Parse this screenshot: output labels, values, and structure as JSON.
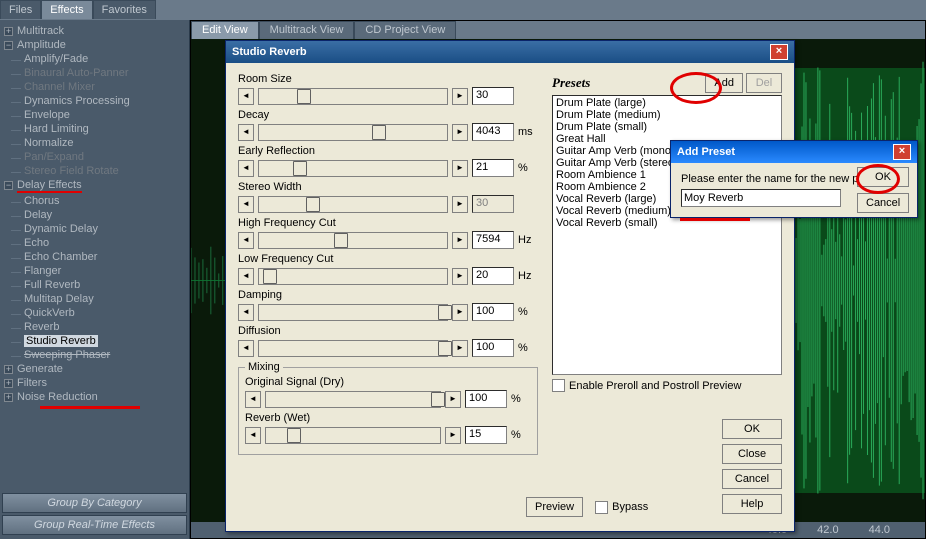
{
  "topbar": {
    "tabs": [
      "Files",
      "Effects",
      "Favorites"
    ],
    "active": 1
  },
  "wave": {
    "tabs": [
      "Edit View",
      "Multitrack View",
      "CD Project View"
    ],
    "active": 0,
    "timeline": [
      "40.0",
      "42.0",
      "44.0"
    ]
  },
  "tree": {
    "multitrack": "Multitrack",
    "amplitude": "Amplitude",
    "amp_children": [
      "Amplify/Fade",
      "Binaural Auto-Panner",
      "Channel Mixer",
      "Dynamics Processing",
      "Envelope",
      "Hard Limiting",
      "Normalize",
      "Pan/Expand",
      "Stereo Field Rotate"
    ],
    "delay": "Delay Effects",
    "delay_children": [
      "Chorus",
      "Delay",
      "Dynamic Delay",
      "Echo",
      "Echo Chamber",
      "Flanger",
      "Full Reverb",
      "Multitap Delay",
      "QuickVerb",
      "Reverb",
      "Studio Reverb",
      "Sweeping Phaser"
    ],
    "selected_idx": 10,
    "generate": "Generate",
    "filters": "Filters",
    "noise": "Noise Reduction"
  },
  "sidebar_btns": {
    "cat": "Group By Category",
    "rt": "Group Real-Time Effects"
  },
  "reverb": {
    "title": "Studio Reverb",
    "params": [
      {
        "label": "Room Size",
        "value": "30",
        "unit": "",
        "pos": 20
      },
      {
        "label": "Decay",
        "value": "4043",
        "unit": "ms",
        "pos": 60
      },
      {
        "label": "Early Reflection",
        "value": "21",
        "unit": "%",
        "pos": 18
      },
      {
        "label": "Stereo Width",
        "value": "30",
        "unit": "",
        "pos": 25,
        "disabled": true
      },
      {
        "label": "High Frequency Cut",
        "value": "7594",
        "unit": "Hz",
        "pos": 40
      },
      {
        "label": "Low Frequency Cut",
        "value": "20",
        "unit": "Hz",
        "pos": 2
      },
      {
        "label": "Damping",
        "value": "100",
        "unit": "%",
        "pos": 95
      },
      {
        "label": "Diffusion",
        "value": "100",
        "unit": "%",
        "pos": 95
      }
    ],
    "mixing_label": "Mixing",
    "mixing": [
      {
        "label": "Original Signal (Dry)",
        "value": "100",
        "unit": "%",
        "pos": 95
      },
      {
        "label": "Reverb (Wet)",
        "value": "15",
        "unit": "%",
        "pos": 12
      }
    ],
    "presets_label": "Presets",
    "add": "Add",
    "del": "Del",
    "preset_items": [
      "Drum Plate (large)",
      "Drum Plate (medium)",
      "Drum Plate (small)",
      "Great Hall",
      "Guitar Amp Verb (mono)",
      "Guitar Amp Verb (stereo)",
      "Room Ambience 1",
      "Room Ambience 2",
      "Vocal Reverb (large)",
      "Vocal Reverb (medium)",
      "Vocal Reverb (small)"
    ],
    "enable_preroll": "Enable Preroll and Postroll Preview",
    "btns": {
      "ok": "OK",
      "close": "Close",
      "cancel": "Cancel",
      "help": "Help",
      "preview": "Preview",
      "bypass": "Bypass"
    }
  },
  "addpreset": {
    "title": "Add Preset",
    "prompt": "Please enter the name for the new preset",
    "value": "Moy Reverb",
    "ok": "OK",
    "cancel": "Cancel"
  }
}
